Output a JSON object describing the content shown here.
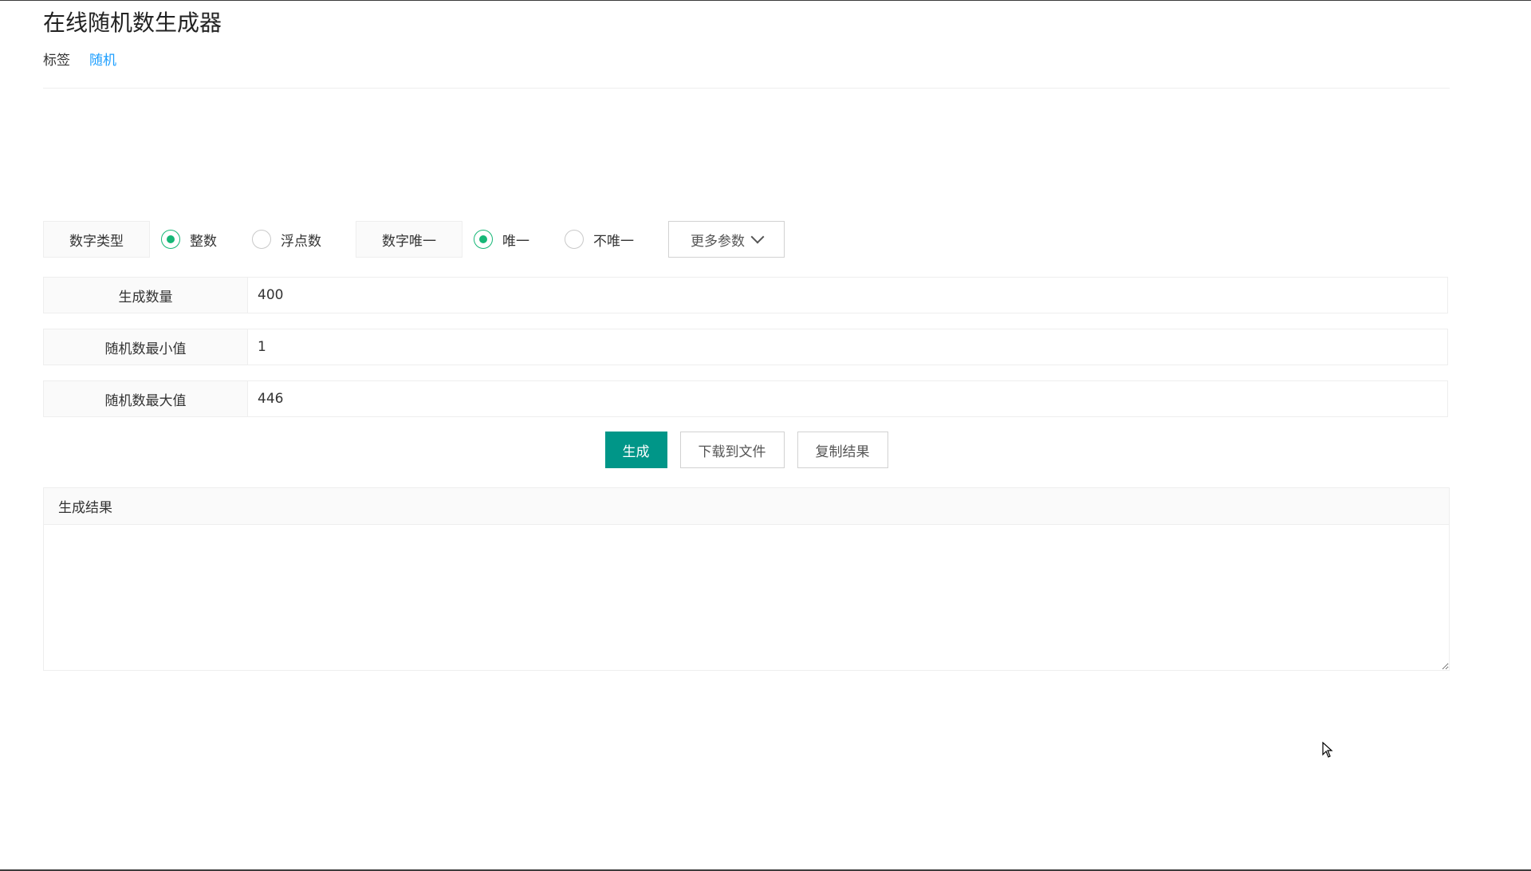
{
  "title": "在线随机数生成器",
  "tags": {
    "label": "标签",
    "items": [
      "随机"
    ]
  },
  "options": {
    "number_type_label": "数字类型",
    "integer_label": "整数",
    "float_label": "浮点数",
    "unique_label": "数字唯一",
    "unique_yes_label": "唯一",
    "unique_no_label": "不唯一",
    "more_params_label": "更多参数"
  },
  "fields": {
    "count": {
      "label": "生成数量",
      "value": "400"
    },
    "min": {
      "label": "随机数最小值",
      "value": "1"
    },
    "max": {
      "label": "随机数最大值",
      "value": "446"
    }
  },
  "actions": {
    "generate_label": "生成",
    "download_label": "下载到文件",
    "copy_label": "复制结果"
  },
  "result": {
    "header": "生成结果",
    "value": ""
  },
  "colors": {
    "primary": "#009688",
    "radio_checked": "#16b777",
    "link": "#1e9fff"
  }
}
